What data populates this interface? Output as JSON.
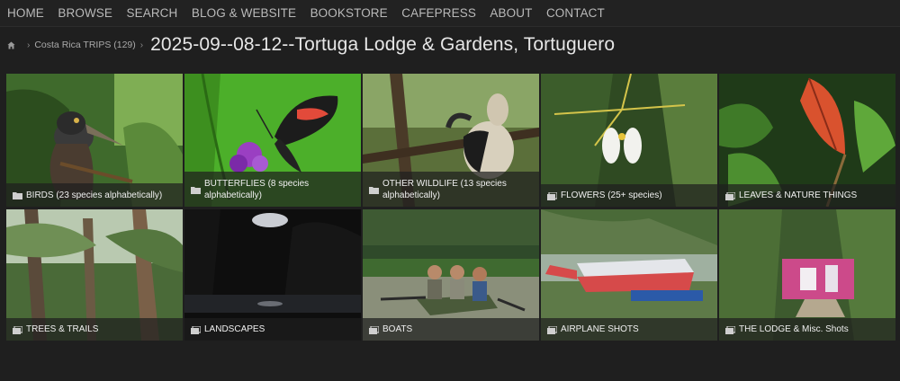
{
  "nav": [
    "HOME",
    "BROWSE",
    "SEARCH",
    "BLOG & WEBSITE",
    "BOOKSTORE",
    "CAFEPRESS",
    "ABOUT",
    "CONTACT"
  ],
  "breadcrumb": {
    "parent": "Costa Rica TRIPS (129)",
    "title": "2025-09--08-12--Tortuga Lodge & Gardens, Tortuguero"
  },
  "galleries": [
    {
      "label": "BIRDS (23 species alphabetically)",
      "icon": "folder-icon"
    },
    {
      "label": "BUTTERFLIES (8 species alphabetically)",
      "icon": "folder-icon"
    },
    {
      "label": "OTHER WILDLIFE (13 species alphabetically)",
      "icon": "folder-icon"
    },
    {
      "label": "FLOWERS (25+ species)",
      "icon": "gallery-icon"
    },
    {
      "label": "LEAVES & NATURE THINGS",
      "icon": "gallery-icon"
    },
    {
      "label": "TREES & TRAILS",
      "icon": "gallery-icon"
    },
    {
      "label": "LANDSCAPES",
      "icon": "gallery-icon"
    },
    {
      "label": "BOATS",
      "icon": "gallery-icon"
    },
    {
      "label": "AIRPLANE SHOTS",
      "icon": "gallery-icon"
    },
    {
      "label": "THE LODGE & Misc. Shots",
      "icon": "gallery-icon"
    }
  ],
  "colors": {
    "background": "#1f1f1f",
    "nav_text": "#b9b9b9",
    "title_text": "#e6e6e6"
  }
}
